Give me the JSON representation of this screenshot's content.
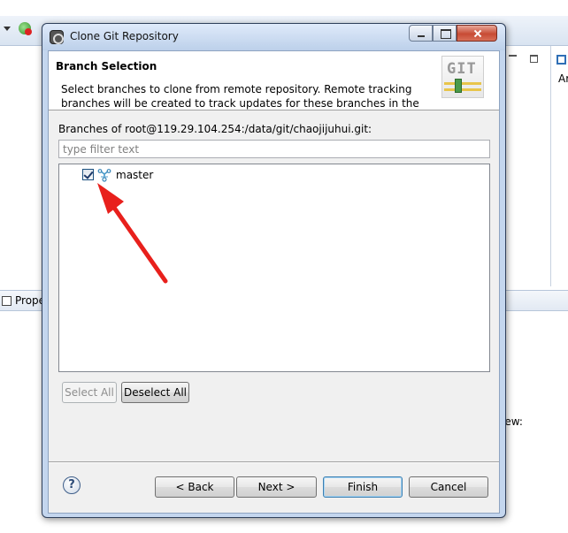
{
  "background": {
    "right_panel_label": "Ar",
    "bottom_tab_label": "Prope",
    "bottom_text": "iew:"
  },
  "dialog": {
    "title": "Clone Git Repository",
    "header": {
      "title": "Branch Selection",
      "description": "Select branches to clone from remote repository. Remote tracking branches will be created to track updates for these branches in the",
      "logo_text": "GIT"
    },
    "branches_label": "Branches of root@119.29.104.254:/data/git/chaojijuhui.git:",
    "filter": {
      "value": "",
      "placeholder": "type filter text"
    },
    "branches": [
      {
        "name": "master",
        "checked": true
      }
    ],
    "buttons": {
      "select_all": "Select All",
      "deselect_all": "Deselect All",
      "back": "< Back",
      "next": "Next >",
      "finish": "Finish",
      "cancel": "Cancel",
      "help": "?"
    }
  },
  "colors": {
    "annotation_arrow": "#e8201c",
    "dialog_frame": "#c4d6ee",
    "close_button": "#c74b34"
  }
}
